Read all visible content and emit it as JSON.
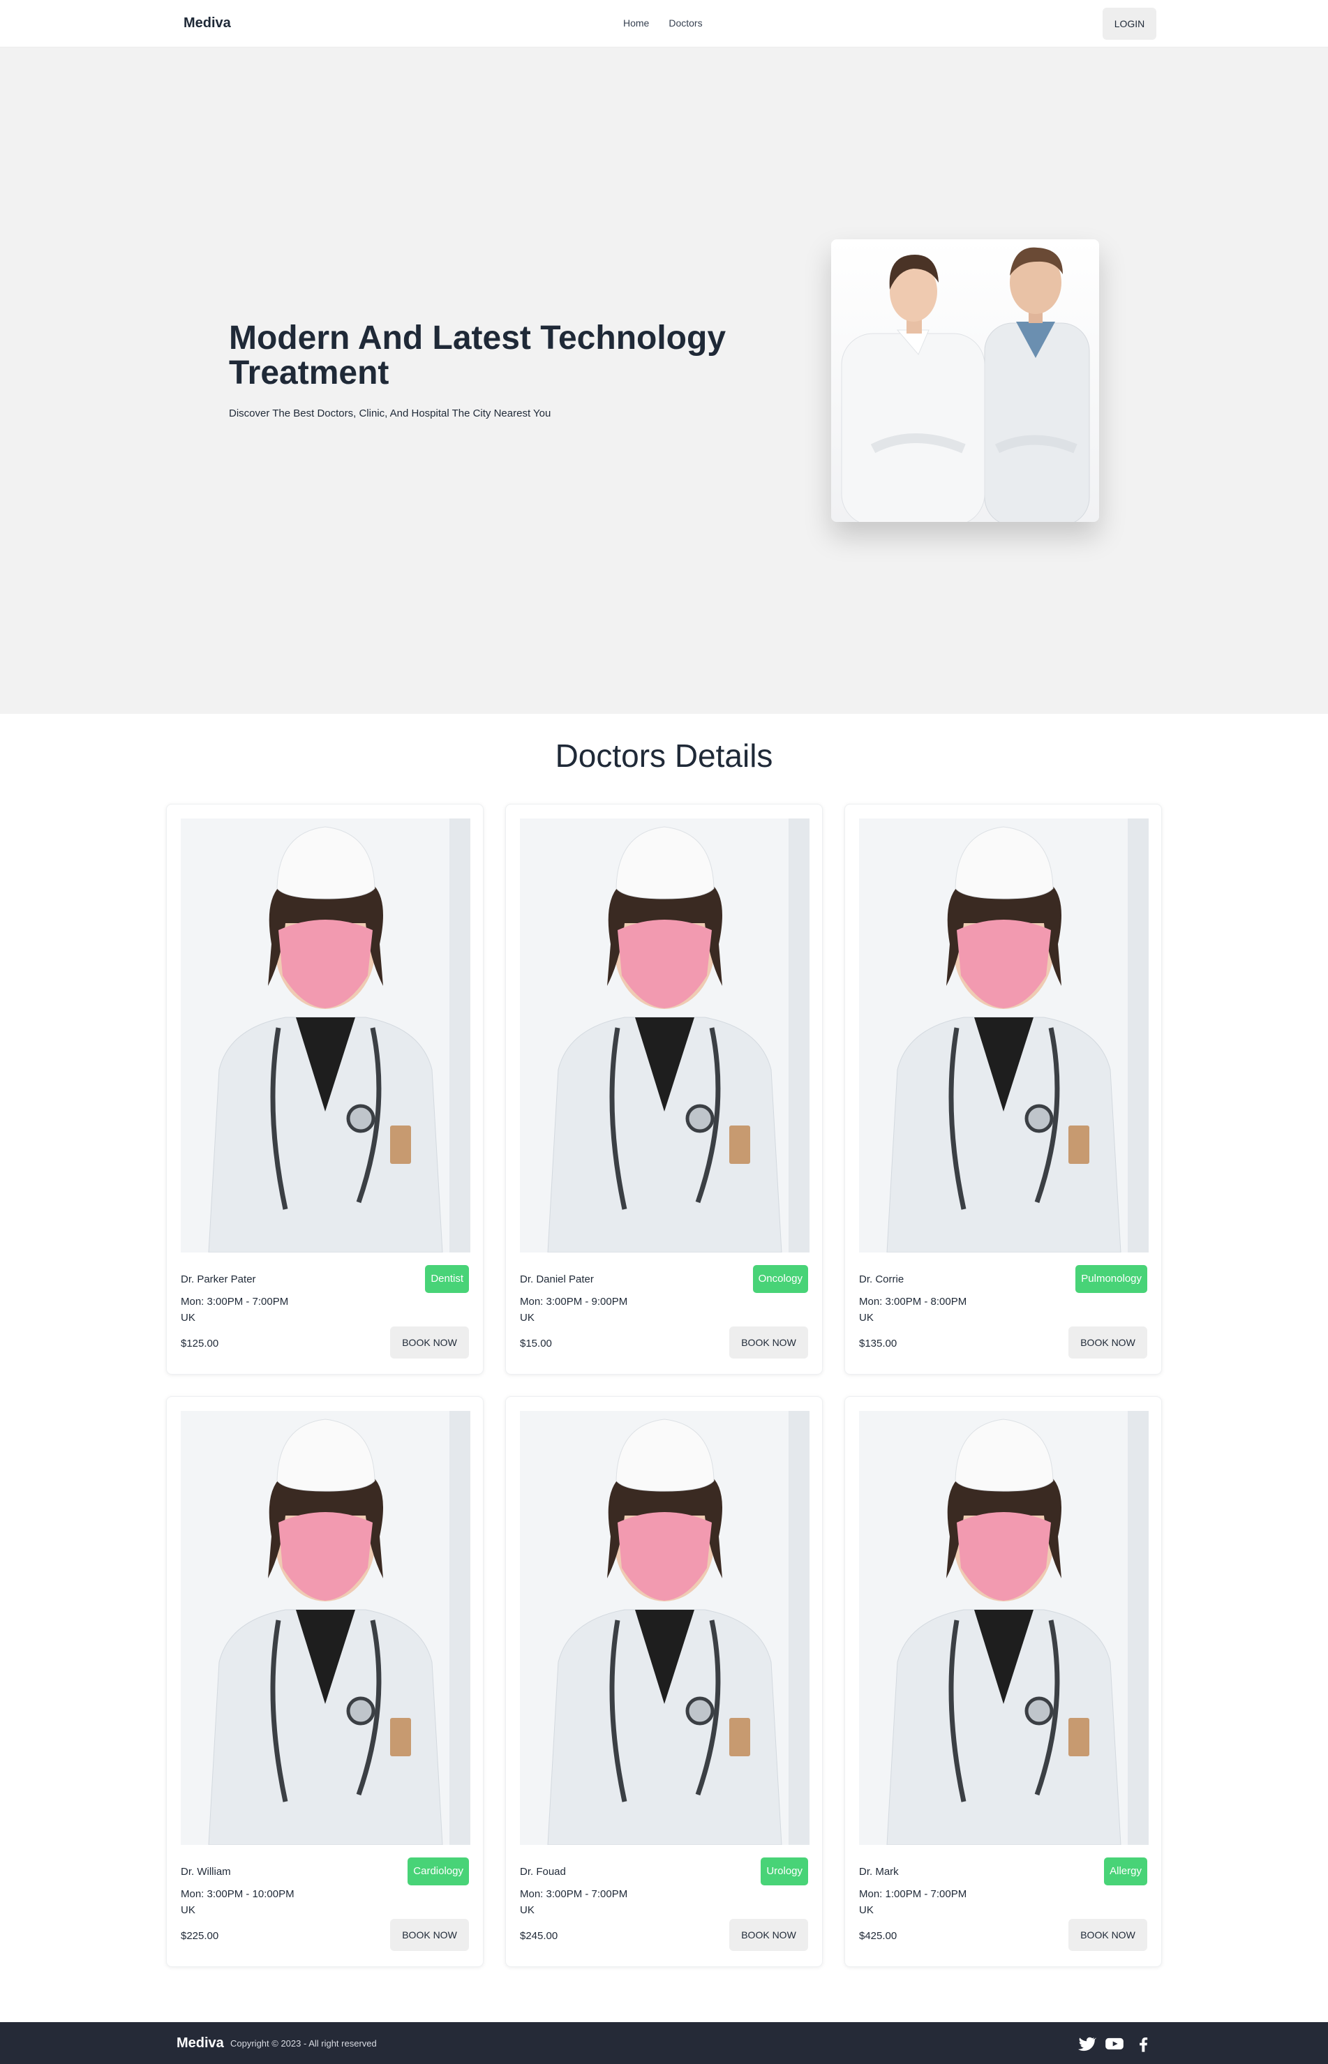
{
  "nav": {
    "brand": "Mediva",
    "links": [
      "Home",
      "Doctors"
    ],
    "login": "LOGIN"
  },
  "hero": {
    "title": "Modern And Latest Technology Treatment",
    "subtitle": "Discover The Best Doctors, Clinic, And Hospital The City Nearest You",
    "image_icon": "doctors-photo"
  },
  "section": {
    "title": "Doctors Details"
  },
  "doctors": [
    {
      "name": "Dr. Parker Pater",
      "specialty": "Dentist",
      "hours": "Mon: 3:00PM - 7:00PM",
      "country": "UK",
      "price": "$125.00",
      "button": "BOOK NOW"
    },
    {
      "name": "Dr. Daniel Pater",
      "specialty": "Oncology",
      "hours": "Mon: 3:00PM - 9:00PM",
      "country": "UK",
      "price": "$15.00",
      "button": "BOOK NOW"
    },
    {
      "name": "Dr. Corrie",
      "specialty": "Pulmonology",
      "hours": "Mon: 3:00PM - 8:00PM",
      "country": "UK",
      "price": "$135.00",
      "button": "BOOK NOW"
    },
    {
      "name": "Dr. William",
      "specialty": "Cardiology",
      "hours": "Mon: 3:00PM - 10:00PM",
      "country": "UK",
      "price": "$225.00",
      "button": "BOOK NOW"
    },
    {
      "name": "Dr. Fouad",
      "specialty": "Urology",
      "hours": "Mon: 3:00PM - 7:00PM",
      "country": "UK",
      "price": "$245.00",
      "button": "BOOK NOW"
    },
    {
      "name": "Dr. Mark",
      "specialty": "Allergy",
      "hours": "Mon: 1:00PM - 7:00PM",
      "country": "UK",
      "price": "$425.00",
      "button": "BOOK NOW"
    }
  ],
  "footer": {
    "brand": "Mediva",
    "copyright": "Copyright © 2023 - All right reserved",
    "social_icons": [
      "twitter-icon",
      "youtube-icon",
      "facebook-icon"
    ]
  },
  "colors": {
    "badge": "#48d377",
    "footer_bg": "#252a37",
    "hero_bg": "#f2f2f2",
    "button_bg": "#eeeeee"
  }
}
